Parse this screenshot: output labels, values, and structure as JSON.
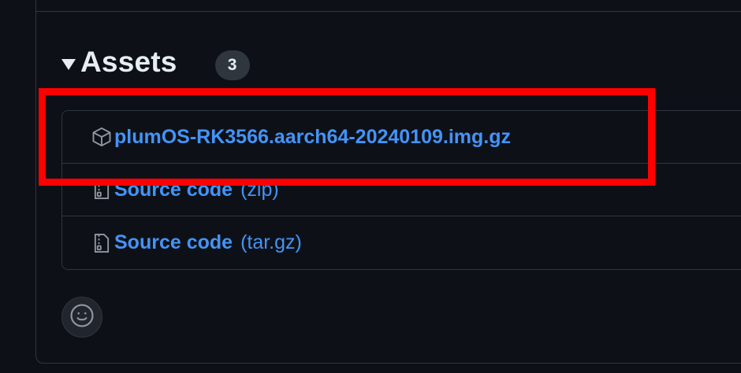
{
  "assets": {
    "title": "Assets",
    "count": "3",
    "items": [
      {
        "name": "plumOS-RK3566.aarch64-20240109.img.gz",
        "suffix": "",
        "icon": "package-icon"
      },
      {
        "name": "Source code",
        "suffix": "(zip)",
        "icon": "file-zip-icon"
      },
      {
        "name": "Source code",
        "suffix": "(tar.gz)",
        "icon": "file-zip-icon"
      }
    ]
  },
  "colors": {
    "background": "#0d1117",
    "border": "#30363d",
    "link": "#4493f8",
    "highlight": "#ff0000"
  }
}
